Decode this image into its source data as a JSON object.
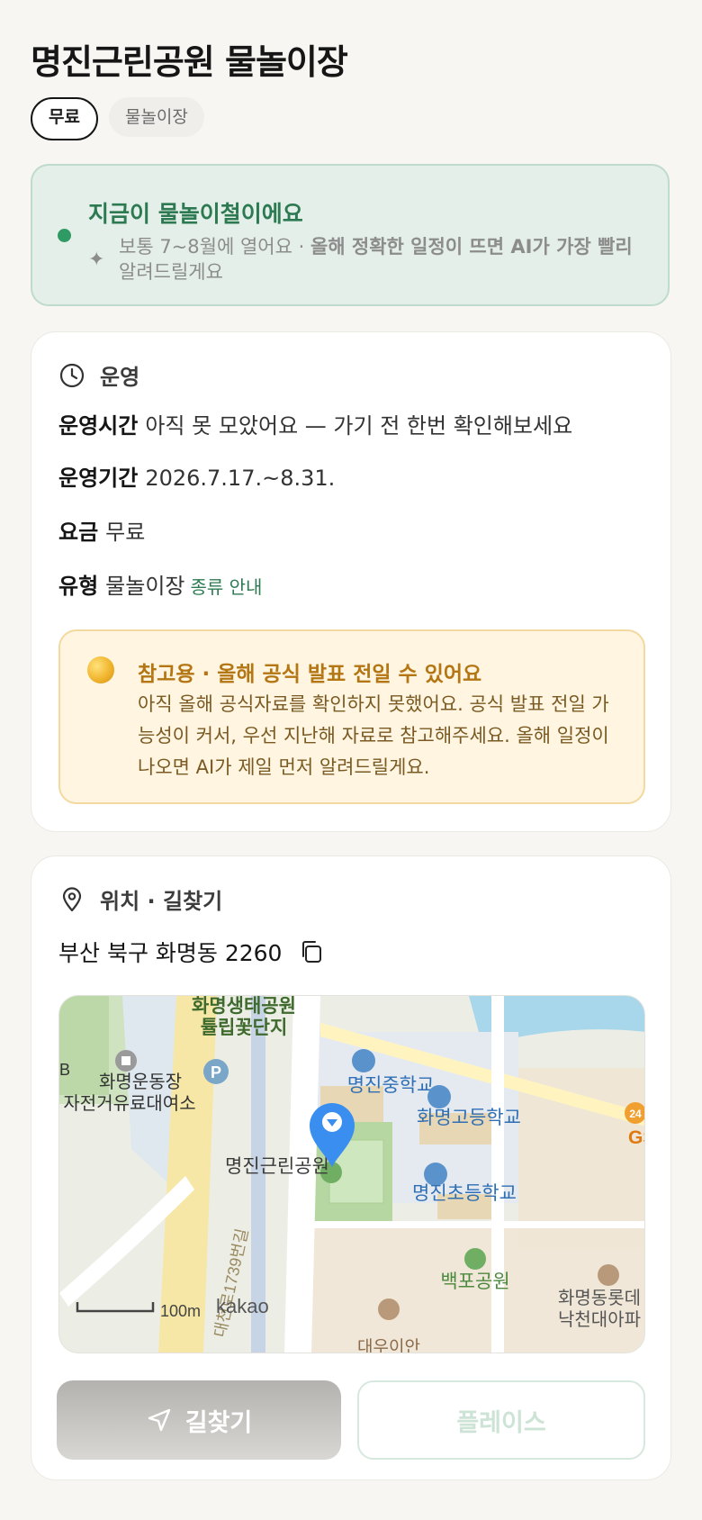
{
  "page": {
    "title": "명진근린공원 물놀이장"
  },
  "chips": [
    {
      "label": "무료",
      "active": true
    },
    {
      "label": "물놀이장",
      "active": false
    }
  ],
  "season": {
    "heading": "지금이 물놀이철이에요",
    "body_normal": "보통 7~8월에 열어요 · ",
    "body_bold": "올해 정확한 일정이 뜨면 AI가 가장 빨리",
    "body_tail": "알려드릴게요",
    "accent_color": "#2f9a63"
  },
  "operation": {
    "section_label": "운영",
    "rows": [
      {
        "key": "운영시간",
        "value": "아직 못 모았어요 — 가기 전 한번 확인해보세요"
      },
      {
        "key": "운영기간",
        "value": "2026.7.17.~8.31."
      },
      {
        "key": "요금",
        "value": "무료"
      },
      {
        "key": "유형",
        "value": "물놀이장",
        "link": "종류 안내"
      }
    ],
    "notice": {
      "title": "참고용 · 올해 공식 발표 전일 수 있어요",
      "text": "아직 올해 공식자료를 확인하지 못했어요. 공식 발표 전일 가능성이 커서, 우선 지난해 자료로 참고해주세요. 올해 일정이 나오면 AI가 제일 먼저 알려드릴게요."
    }
  },
  "location": {
    "section_label": "위치 · 길찾기",
    "address": "부산 북구 화명동 2260",
    "map": {
      "labels": {
        "park_top": "화명생태공원",
        "park_top2": "튤립꽃단지",
        "stadium": "화명운동장",
        "bike": "자전거유료대여소",
        "school_mid": "명진중학교",
        "school_high": "화명고등학교",
        "school_elem": "명진초등학교",
        "park_main": "명진근린공원",
        "park_baekpo": "백포공원",
        "road": "대천로1739번길",
        "apt": "화명동롯데",
        "apt2": "낙천대아파",
        "gs": "GS",
        "scale": "100m",
        "provider": "kakao",
        "bottom_cut": "대우이안",
        "b_letter": "B",
        "parking": "P",
        "badge_24": "24"
      }
    },
    "buttons": {
      "directions": "길찾기",
      "place": "플레이스"
    }
  }
}
